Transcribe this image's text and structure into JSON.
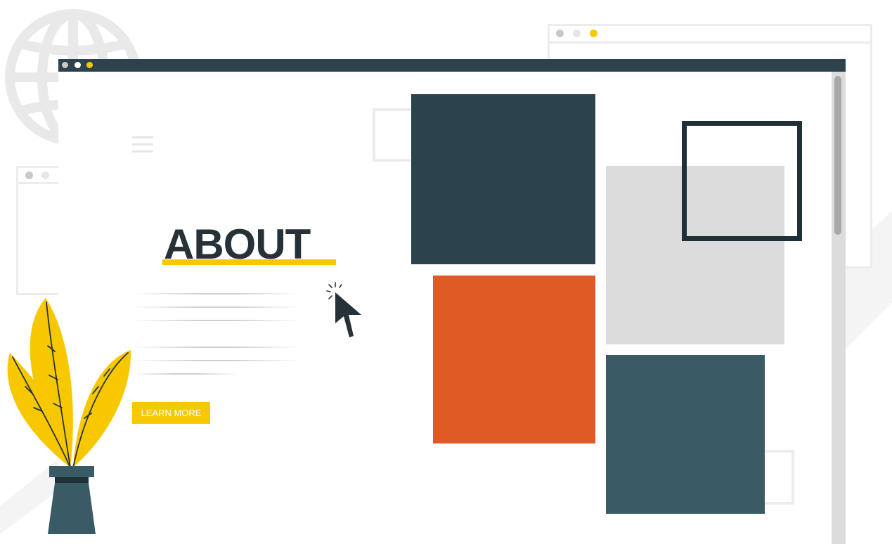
{
  "about": {
    "title": "ABOUT",
    "button_label": "LEARN MORE"
  },
  "colors": {
    "dark_navy": "#2c434e",
    "accent_yellow": "#f7c800",
    "accent_orange": "#e05a26",
    "light_gray": "#dcdcdc",
    "slate": "#3a5a66",
    "frame_dark": "#1e3038"
  },
  "icons": [
    "globe-icon",
    "hamburger-menu-icon",
    "cursor-click-icon",
    "plant-illustration"
  ]
}
